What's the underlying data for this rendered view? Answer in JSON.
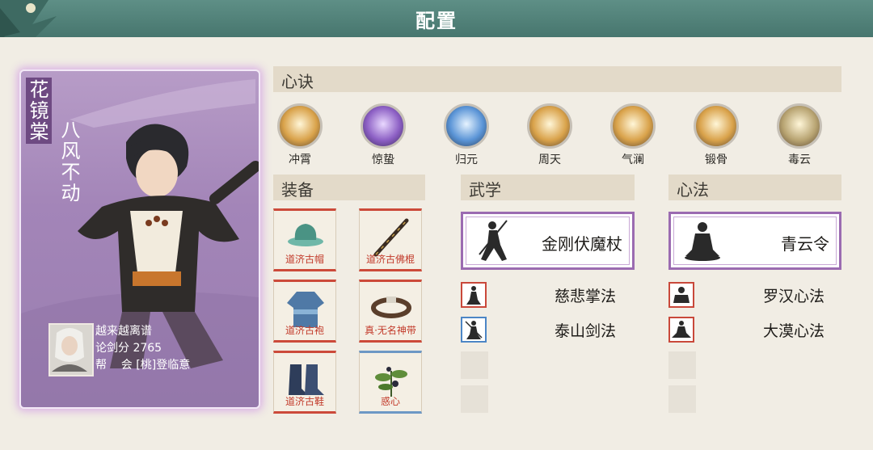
{
  "header": {
    "title": "配置"
  },
  "character": {
    "name": "花镜棠",
    "motto": "八风不动",
    "player_name": "越来越离谱",
    "score_label": "论剑分",
    "score_value": "2765",
    "guild_label": "帮    会",
    "guild_value": "[桃]登临意"
  },
  "sections": {
    "xinjue": "心诀",
    "equipment": "装备",
    "wuxue": "武学",
    "xinfa": "心法"
  },
  "xinjue_skills": [
    {
      "label": "冲霄",
      "icon": "swirl-icon",
      "color": "#d9a24a"
    },
    {
      "label": "惊蛰",
      "icon": "lightning-icon",
      "color": "#8c5fc4"
    },
    {
      "label": "归元",
      "icon": "meditation-icon",
      "color": "#5a94d6"
    },
    {
      "label": "周天",
      "icon": "flame-icon",
      "color": "#d9a24a"
    },
    {
      "label": "气澜",
      "icon": "meditation-icon",
      "color": "#d9a24a"
    },
    {
      "label": "锻骨",
      "icon": "wheel-icon",
      "color": "#d9a24a"
    },
    {
      "label": "毒云",
      "icon": "cloud-icon",
      "color": "#b8a472"
    }
  ],
  "equipment": [
    {
      "label": "道济古帽",
      "icon": "hat-icon"
    },
    {
      "label": "道济古佛棍",
      "icon": "staff-icon"
    },
    {
      "label": "道济古袍",
      "icon": "robe-icon"
    },
    {
      "label": "真·无名神带",
      "icon": "belt-icon"
    },
    {
      "label": "道济古鞋",
      "icon": "boots-icon"
    },
    {
      "label": "惑心",
      "icon": "plant-icon"
    }
  ],
  "wuxue": {
    "main": "金刚伏魔杖",
    "secondary": [
      "慈悲掌法",
      "泰山剑法"
    ]
  },
  "xinfa": {
    "main": "青云令",
    "secondary": [
      "罗汉心法",
      "大漠心法"
    ]
  }
}
